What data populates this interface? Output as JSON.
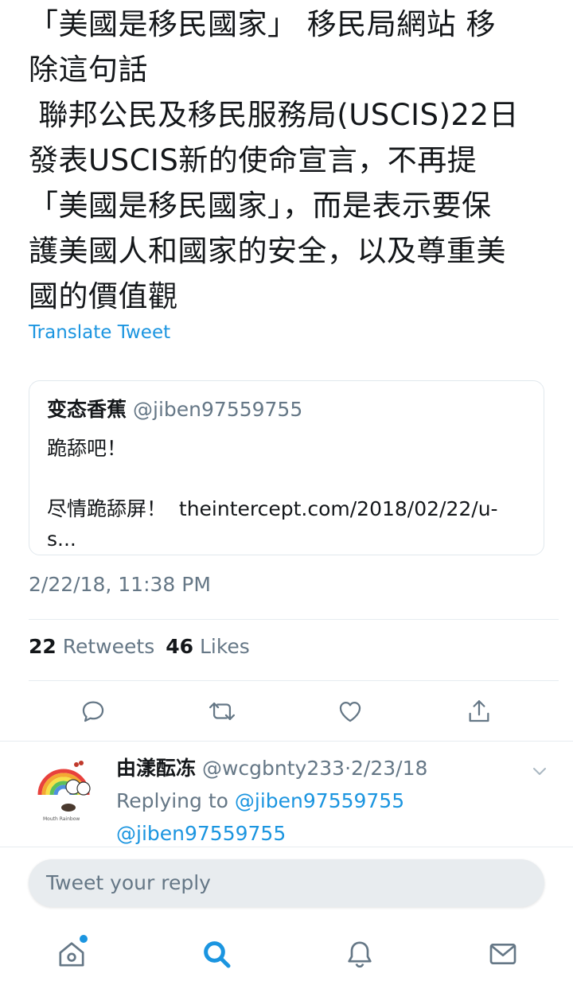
{
  "tweet": {
    "text": "「美國是移民國家」 移民局網站 移\n除這句話\n 聯邦公民及移民服務局(USCIS)22日\n發表USCIS新的使命宣言，不再提\n「美國是移民國家」，而是表示要保\n護美國人和國家的安全，以及尊重美\n國的價值觀",
    "translate_label": "Translate Tweet",
    "timestamp": "2/22/18, 11:38 PM"
  },
  "quote": {
    "name": "变态香蕉",
    "handle": "@jiben97559755",
    "body": "跪舔吧！\n\n尽情跪舔屏！  theintercept.com/2018/02/22/u-s..."
  },
  "stats": {
    "retweets_count": "22",
    "retweets_label": "Retweets",
    "likes_count": "46",
    "likes_label": "Likes"
  },
  "actions": [
    "reply-icon",
    "retweet-icon",
    "like-icon",
    "share-icon"
  ],
  "reply": {
    "name": "由漾酝冻",
    "handle": "@wcgbnty233",
    "separator": "·",
    "date": "2/23/18",
    "replying_prefix": "Replying to ",
    "replying_to_1": "@jiben97559755",
    "replying_to_2": "@jiben97559755",
    "avatar_caption": "Mouth Rainbow"
  },
  "compose": {
    "placeholder": "Tweet your reply"
  },
  "tabs": [
    "home-icon",
    "search-icon",
    "notifications-icon",
    "messages-icon"
  ],
  "colors": {
    "accent": "#1b95e0",
    "text": "#14171a",
    "secondary": "#657786",
    "border": "#e6ecf0",
    "compose_bg": "#e8ecef"
  }
}
